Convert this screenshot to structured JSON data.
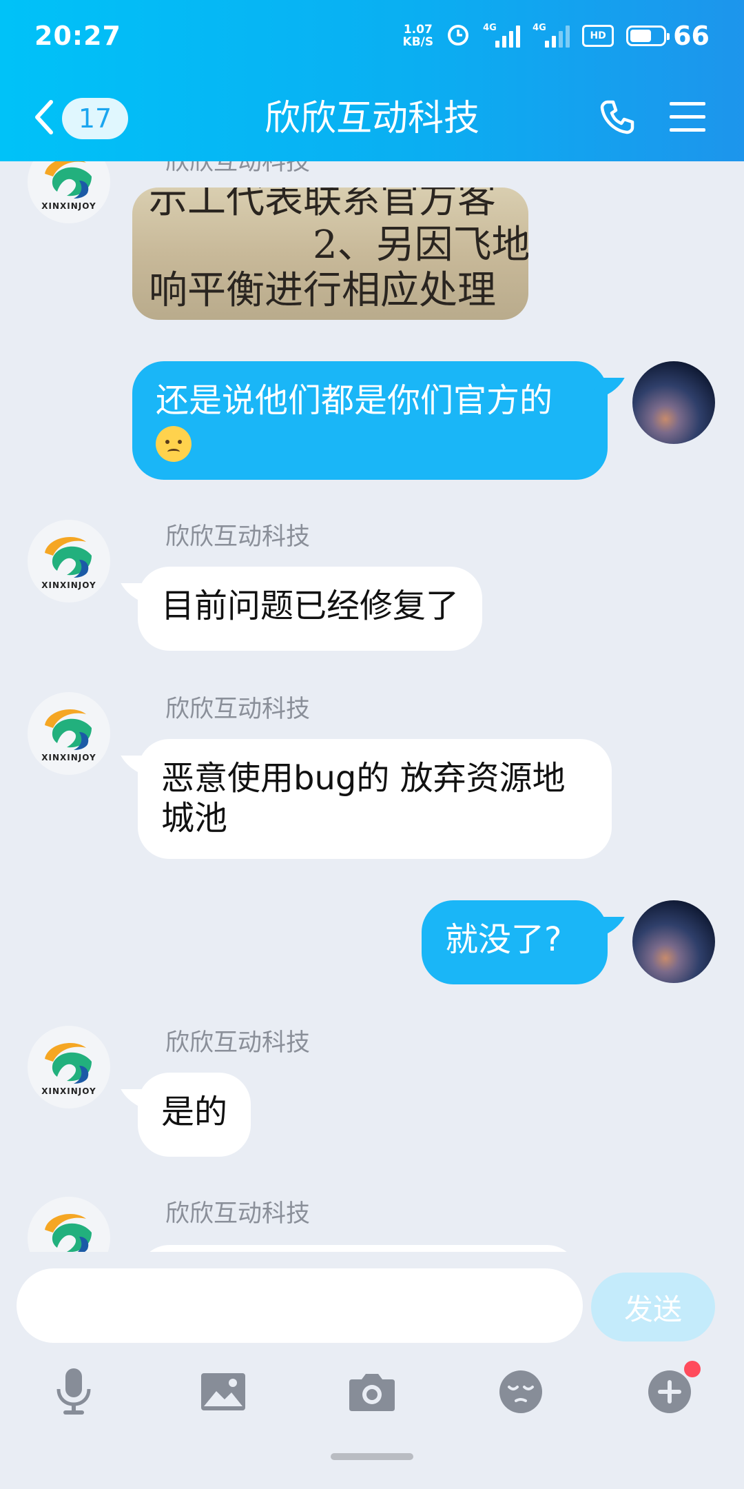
{
  "status_bar": {
    "time": "20:27",
    "net_speed_value": "1.07",
    "net_speed_unit": "KB/S",
    "signal_1_label": "4G",
    "signal_2_label": "4G",
    "hd_label": "HD",
    "battery_level": "66"
  },
  "header": {
    "unread_count": "17",
    "title": "欣欣互动科技"
  },
  "chat": {
    "partial_image_sender": "欣欣互动科技",
    "image_message": {
      "line1": "示工代表联系官方客",
      "line2": "2、另因飞地",
      "line3": "响平衡进行相应处理"
    },
    "messages": [
      {
        "direction": "outgoing",
        "text": "还是说他们都是你们官方的"
      },
      {
        "direction": "incoming",
        "sender": "欣欣互动科技",
        "text": "目前问题已经修复了"
      },
      {
        "direction": "incoming",
        "sender": "欣欣互动科技",
        "text": "恶意使用bug的 放弃资源地城池"
      },
      {
        "direction": "outgoing",
        "text": "就没了?"
      },
      {
        "direction": "incoming",
        "sender": "欣欣互动科技",
        "text": "是的"
      },
      {
        "direction": "incoming",
        "sender": "欣欣互动科技",
        "text": ""
      }
    ],
    "logo_brand": "XINXINJOY"
  },
  "input": {
    "placeholder": "",
    "send_label": "发送"
  },
  "toolbar": {
    "icons": [
      "microphone-icon",
      "image-icon",
      "camera-icon",
      "emoji-icon",
      "plus-icon"
    ]
  },
  "colors": {
    "header_start": "#00c2f8",
    "header_end": "#1d95ec",
    "outgoing_bubble": "#1ab6f7",
    "incoming_bubble": "#ffffff",
    "background": "#e9edf4",
    "send_button": "#c4ebfb",
    "badge_dot": "#ff4b5c"
  }
}
